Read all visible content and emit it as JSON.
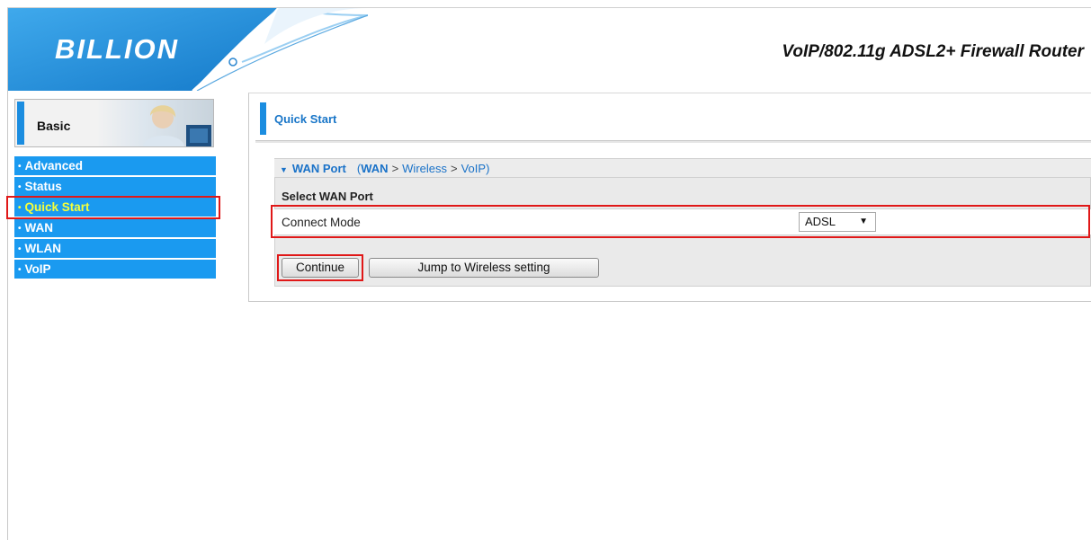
{
  "header": {
    "logo_text": "BILLION",
    "product_title": "VoIP/802.11g ADSL2+ Firewall Router"
  },
  "sidebar": {
    "section_label": "Basic",
    "items": [
      {
        "label": "Advanced"
      },
      {
        "label": "Status"
      },
      {
        "label": "Quick Start",
        "active": true
      },
      {
        "label": "WAN"
      },
      {
        "label": "WLAN"
      },
      {
        "label": "VoIP"
      }
    ]
  },
  "main": {
    "page_title": "Quick Start",
    "wan_section": {
      "title": "WAN Port",
      "breadcrumb": [
        "WAN",
        "Wireless",
        "VoIP"
      ]
    },
    "select_wan_label": "Select WAN Port",
    "connect_mode_label": "Connect Mode",
    "connect_mode_value": "ADSL",
    "continue_label": "Continue",
    "jump_label": "Jump to Wireless setting"
  },
  "colors": {
    "accent_blue": "#1a9af0",
    "active_item": "#f4ff3a",
    "highlight_red": "#e01818"
  }
}
